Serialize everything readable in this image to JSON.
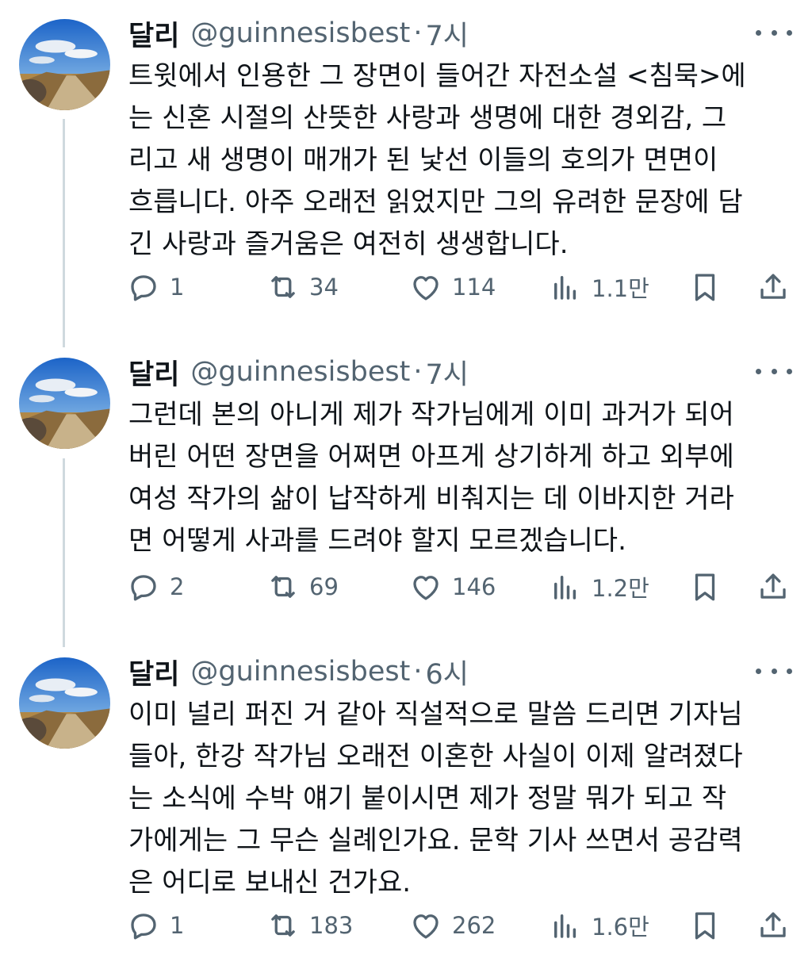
{
  "tweets": [
    {
      "name": "달리",
      "handle": "@guinnesisbest",
      "separator": "·",
      "time": "7시",
      "lines": [
        "트윗에서 인용한 그 장면이 들어간 자전소설 <침묵>에",
        "는 신혼 시절의 산뜻한 사랑과 생명에 대한 경외감, 그",
        "리고 새 생명이 매개가 된 낯선 이들의 호의가 면면이",
        "흐릅니다. 아주 오래전 읽었지만 그의 유려한 문장에 담",
        "긴 사랑과 즐거움은 여전히 생생합니다."
      ],
      "replies": "1",
      "retweets": "34",
      "likes": "114",
      "views": "1.1만"
    },
    {
      "name": "달리",
      "handle": "@guinnesisbest",
      "separator": "·",
      "time": "7시",
      "lines": [
        "그런데 본의 아니게 제가 작가님에게 이미 과거가 되어",
        "버린 어떤 장면을 어쩌면 아프게 상기하게 하고 외부에",
        "여성 작가의 삶이 납작하게 비춰지는 데 이바지한 거라",
        "면 어떻게 사과를 드려야 할지 모르겠습니다."
      ],
      "replies": "2",
      "retweets": "69",
      "likes": "146",
      "views": "1.2만"
    },
    {
      "name": "달리",
      "handle": "@guinnesisbest",
      "separator": "·",
      "time": "6시",
      "lines": [
        "이미 널리 퍼진 거 같아 직설적으로 말씀 드리면 기자님",
        "들아, 한강 작가님 오래전 이혼한 사실이 이제 알려졌다",
        "는 소식에 수박 얘기 붙이시면 제가 정말 뭐가 되고 작",
        "가에게는 그 무슨 실례인가요. 문학 기사 쓰면서 공감력",
        "은 어디로 보내신 건가요."
      ],
      "replies": "1",
      "retweets": "183",
      "likes": "262",
      "views": "1.6만"
    }
  ],
  "icons": {
    "reply": "reply-icon",
    "retweet": "retweet-icon",
    "like": "heart-icon",
    "views": "views-icon",
    "bookmark": "bookmark-icon",
    "share": "share-icon",
    "more": "more-icon"
  },
  "colors": {
    "text": "#0f1419",
    "secondary": "#536471",
    "thread_line": "#cfd9de"
  }
}
